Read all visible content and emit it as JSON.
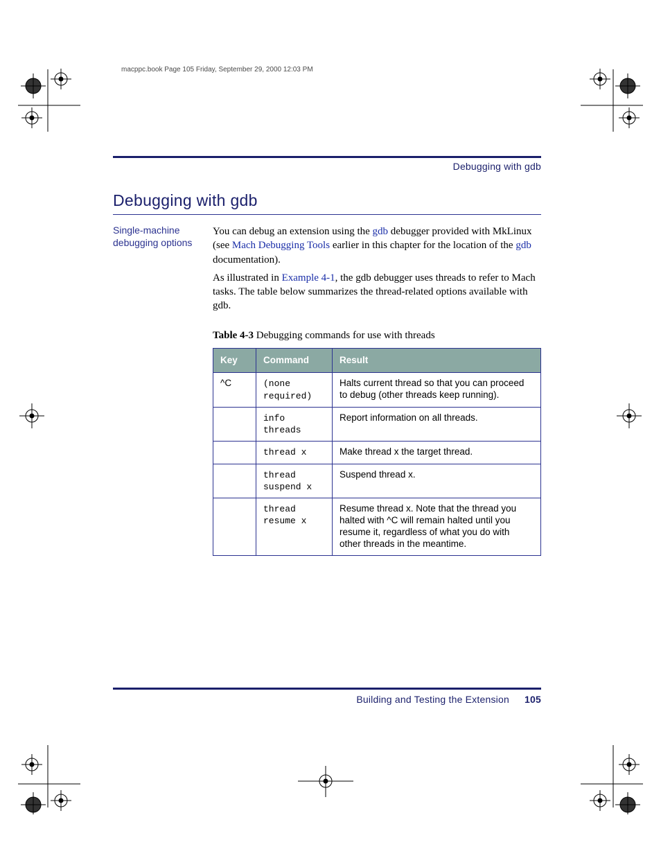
{
  "slug": {
    "file": "macppc.book  Page 105  Friday, September 29, 2000  12:03 PM"
  },
  "runhead": "Debugging with gdb",
  "section": {
    "heading": "Debugging with gdb",
    "margin_label": "Single-machine debugging options"
  },
  "paragraphs": {
    "p1_a": "You can debug an extension using the ",
    "p1_link1": "gdb",
    "p1_b": " debugger provided with MkLinux (see ",
    "p1_link2": "Mach Debugging Tools",
    "p1_c": " earlier in this chapter for the location of the ",
    "p1_link3": "gdb",
    "p1_d": " documentation).",
    "p2_a": "As illustrated in ",
    "p2_link": "Example 4-1",
    "p2_b": ", the gdb debugger uses threads to refer to Mach tasks. The table below summarizes the thread-related options available with gdb."
  },
  "table": {
    "caption_strong": "Table 4-3",
    "caption_rest": "  Debugging commands for use with threads",
    "headers": [
      "Key",
      "Command",
      "Result"
    ],
    "rows": [
      {
        "key": "^C",
        "cmd_lines": [
          "(none",
          "required)"
        ],
        "result_lines": [
          "Halts current thread so that you can proceed",
          "to debug (other threads keep running)."
        ]
      },
      {
        "key": "",
        "cmd_lines": [
          "info",
          "threads"
        ],
        "result_lines": [
          "Report information on all threads."
        ]
      },
      {
        "key": "",
        "cmd_lines": [
          "thread x"
        ],
        "result_lines": [
          "Make thread x the target thread."
        ]
      },
      {
        "key": "",
        "cmd_lines": [
          "thread",
          "suspend x"
        ],
        "result_lines": [
          "Suspend thread x."
        ]
      },
      {
        "key": "",
        "cmd_lines": [
          "thread",
          "resume x"
        ],
        "result_lines": [
          "Resume thread x. Note that the thread you",
          "halted with ^C will remain halted until you",
          "resume it, regardless of what you do with",
          "other threads in the meantime."
        ]
      }
    ]
  },
  "footer": {
    "text": "Building and Testing the Extension",
    "page": "105"
  }
}
